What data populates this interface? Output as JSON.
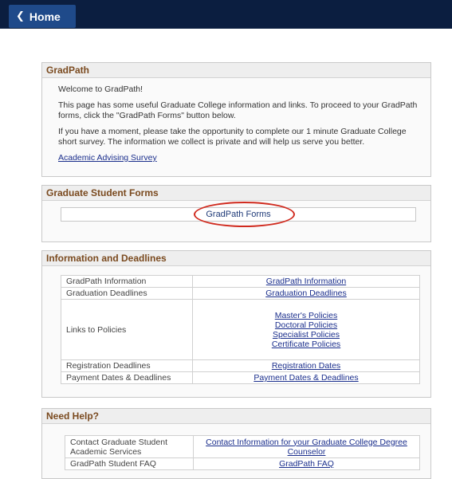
{
  "nav": {
    "home_label": "Home"
  },
  "gradpath": {
    "title": "GradPath",
    "welcome": "Welcome to GradPath!",
    "intro": "This page has some useful Graduate College information and links. To proceed to your GradPath forms, click the \"GradPath Forms\" button below.",
    "survey_text": "If you have a moment, please take the opportunity to complete our 1 minute Graduate College short survey. The information we collect is private and will help us serve you better.",
    "survey_link": "Academic Advising Survey"
  },
  "forms": {
    "title": "Graduate Student Forms",
    "button_label": "GradPath Forms"
  },
  "info": {
    "title": "Information and Deadlines",
    "rows": [
      {
        "label": "GradPath Information",
        "links": [
          "GradPath Information"
        ]
      },
      {
        "label": "Graduation Deadlines",
        "links": [
          "Graduation Deadlines"
        ]
      },
      {
        "label": "Links to Policies",
        "links": [
          "Master's Policies",
          "Doctoral Policies",
          "Specialist Policies",
          "Certificate Policies"
        ]
      },
      {
        "label": "Registration Deadlines",
        "links": [
          "Registration Dates"
        ]
      },
      {
        "label": "Payment Dates & Deadlines",
        "links": [
          "Payment Dates & Deadlines"
        ]
      }
    ]
  },
  "help": {
    "title": "Need Help?",
    "rows": [
      {
        "label": "Contact Graduate Student Academic Services",
        "link": "Contact Information for your Graduate College Degree Counselor"
      },
      {
        "label": "GradPath Student FAQ",
        "link": "GradPath FAQ"
      }
    ]
  }
}
